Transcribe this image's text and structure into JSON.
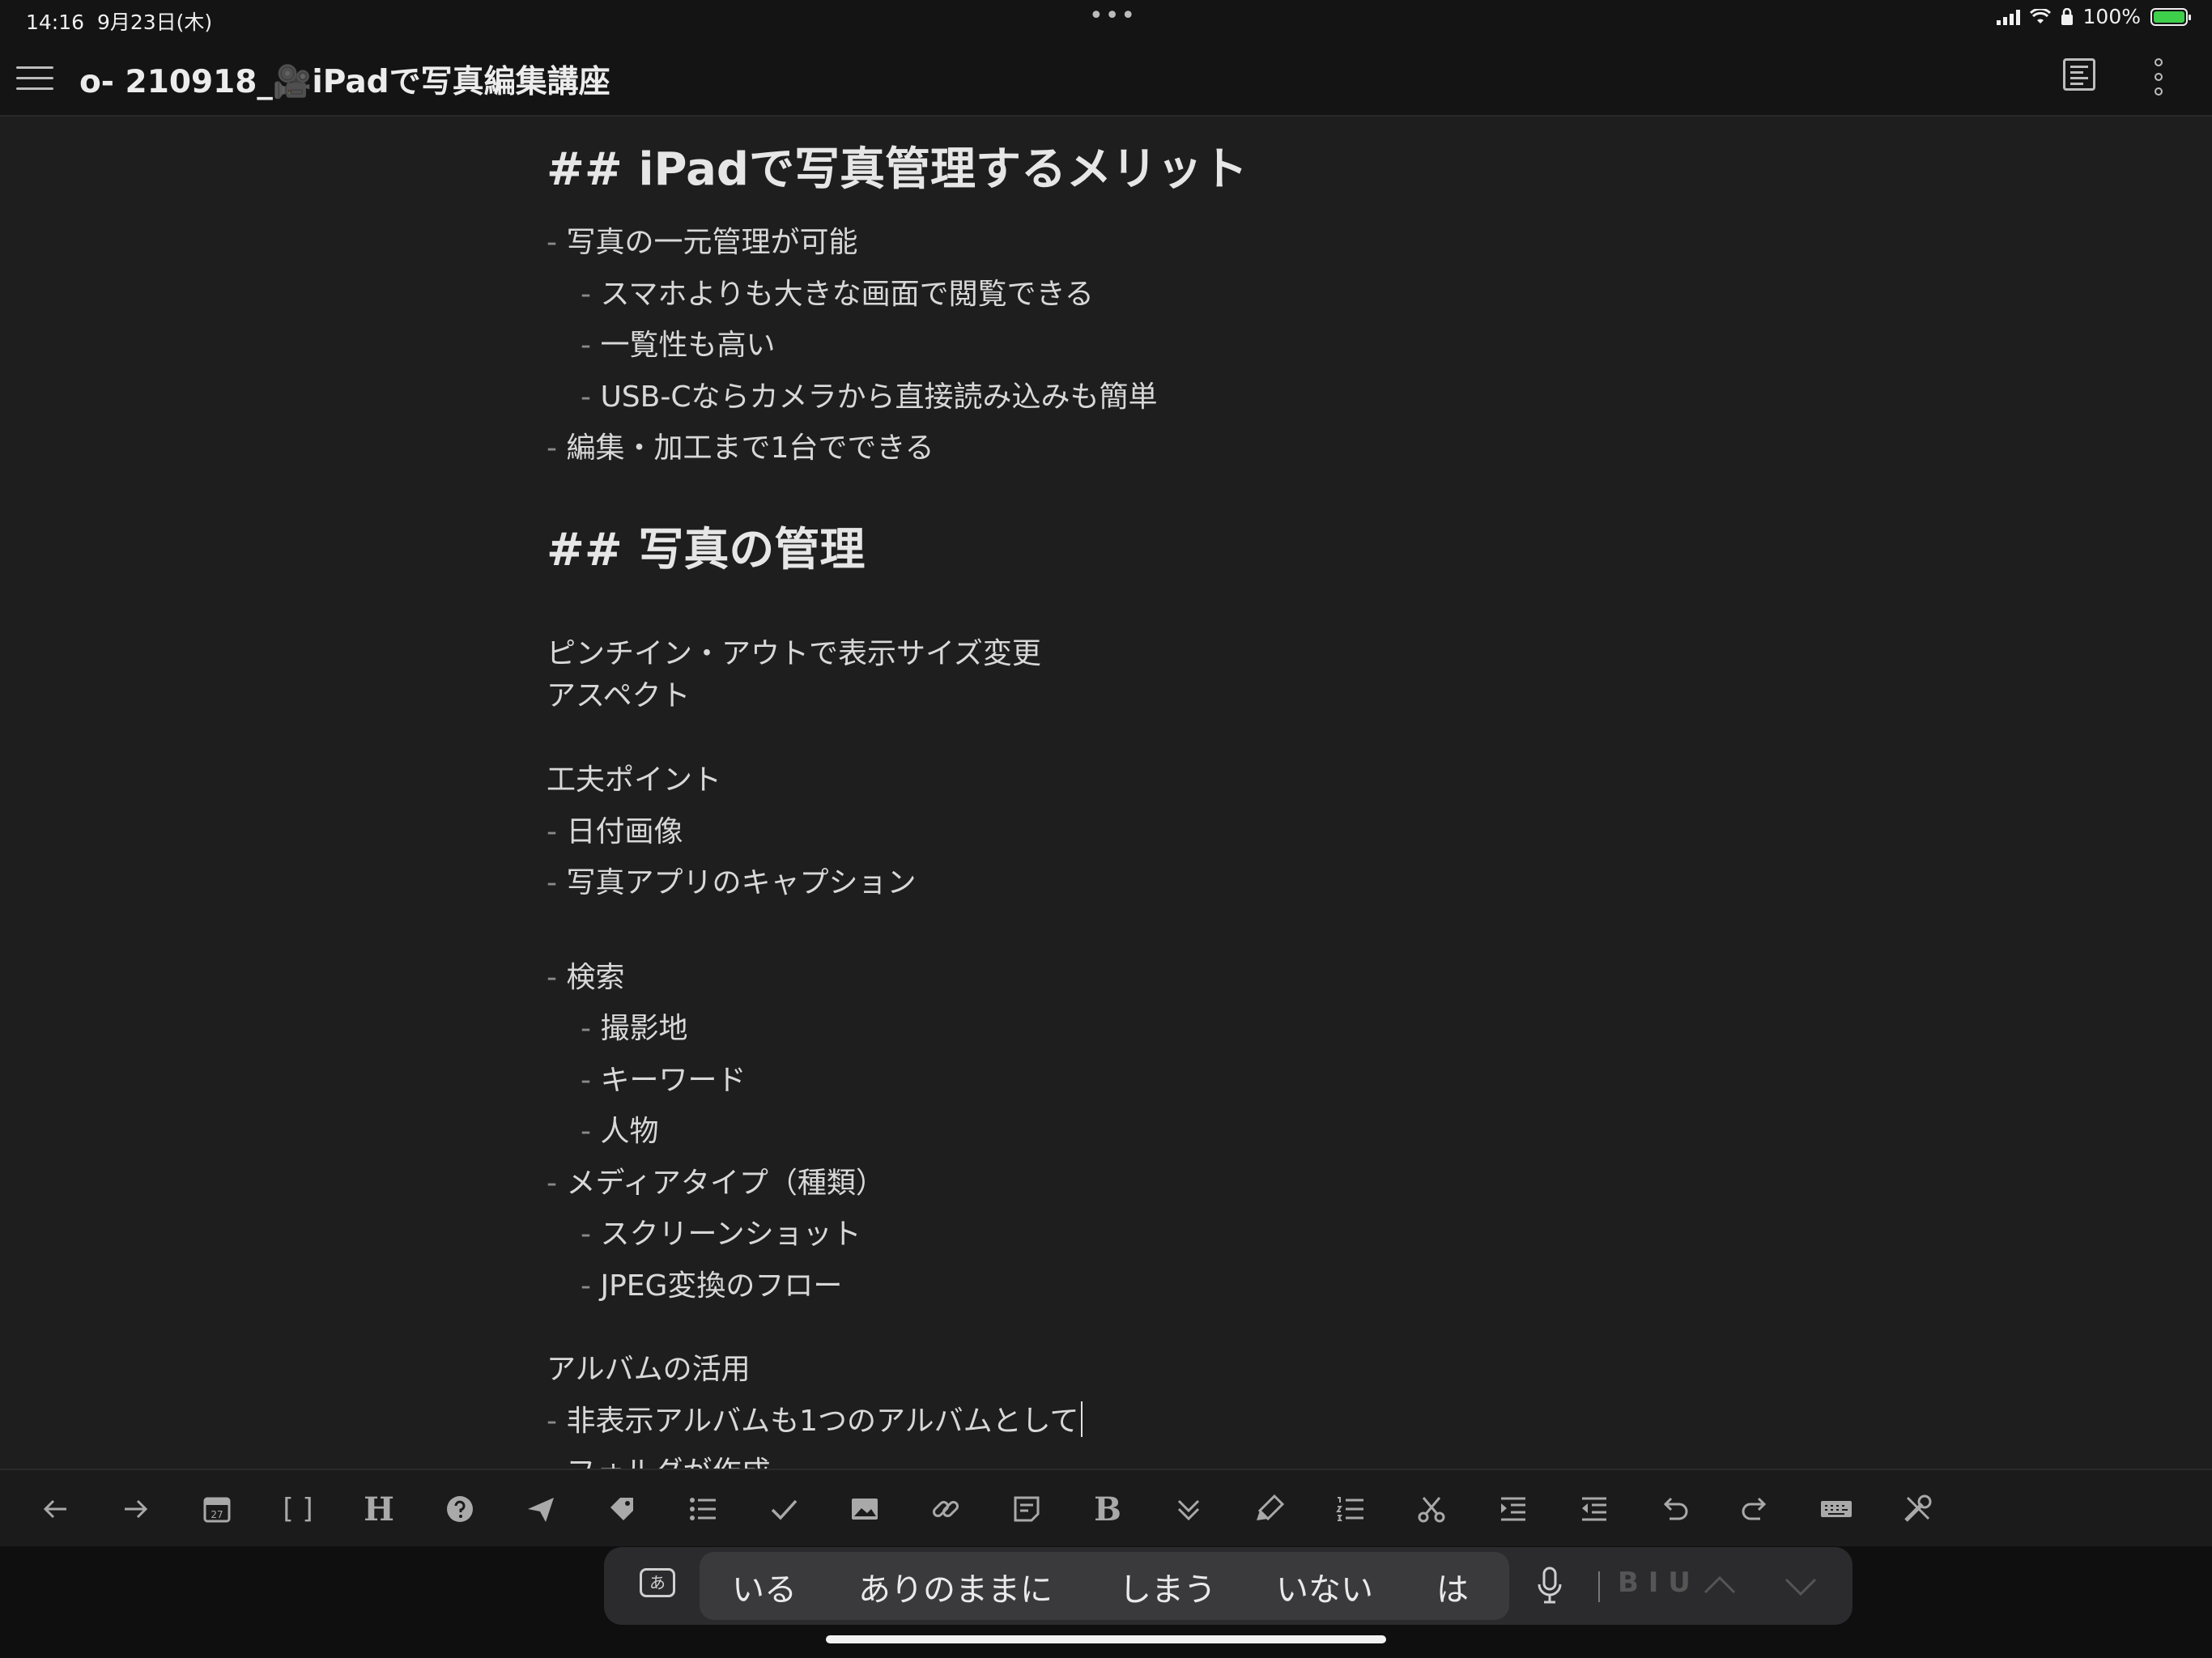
{
  "status_bar": {
    "time": "14:16",
    "date": "9月23日(木)",
    "dots": "•••",
    "battery": "100%"
  },
  "header": {
    "title": "o- 210918_🎥iPadで写真編集講座"
  },
  "document": {
    "h_merit": "## iPadで写真管理するメリット",
    "l1": "写真の一元管理が可能",
    "l2": "スマホよりも大きな画面で閲覧できる",
    "l3": "一覧性も高い",
    "l4": "USB-Cならカメラから直接読み込みも簡単",
    "l5": "編集・加工まで1台でできる",
    "h_manage": "## 写真の管理",
    "p1": "ピンチイン・アウトで表示サイズ変更",
    "p2": "アスペクト",
    "p3": "工夫ポイント",
    "l6": "日付画像",
    "l7": "写真アプリのキャプション",
    "l8": "検索",
    "l9": "撮影地",
    "l10": "キーワード",
    "l11": "人物",
    "l12": "メディアタイプ（種類）",
    "l13": "スクリーンショット",
    "l14": "JPEG変換のフロー",
    "p4": "アルバムの活用",
    "l15": "非表示アルバムも1つのアルバムとして",
    "l16": "フォルダが作成",
    "marker": "-"
  },
  "toolbar": {
    "heading": "H",
    "brackets": "[ ]",
    "bold": "B",
    "calendar_day": "27"
  },
  "keyboard": {
    "ime_label": "あ",
    "suggestions": [
      "いる",
      "ありのままに",
      "しまう",
      "いない",
      "は"
    ],
    "biu": "B I U"
  }
}
